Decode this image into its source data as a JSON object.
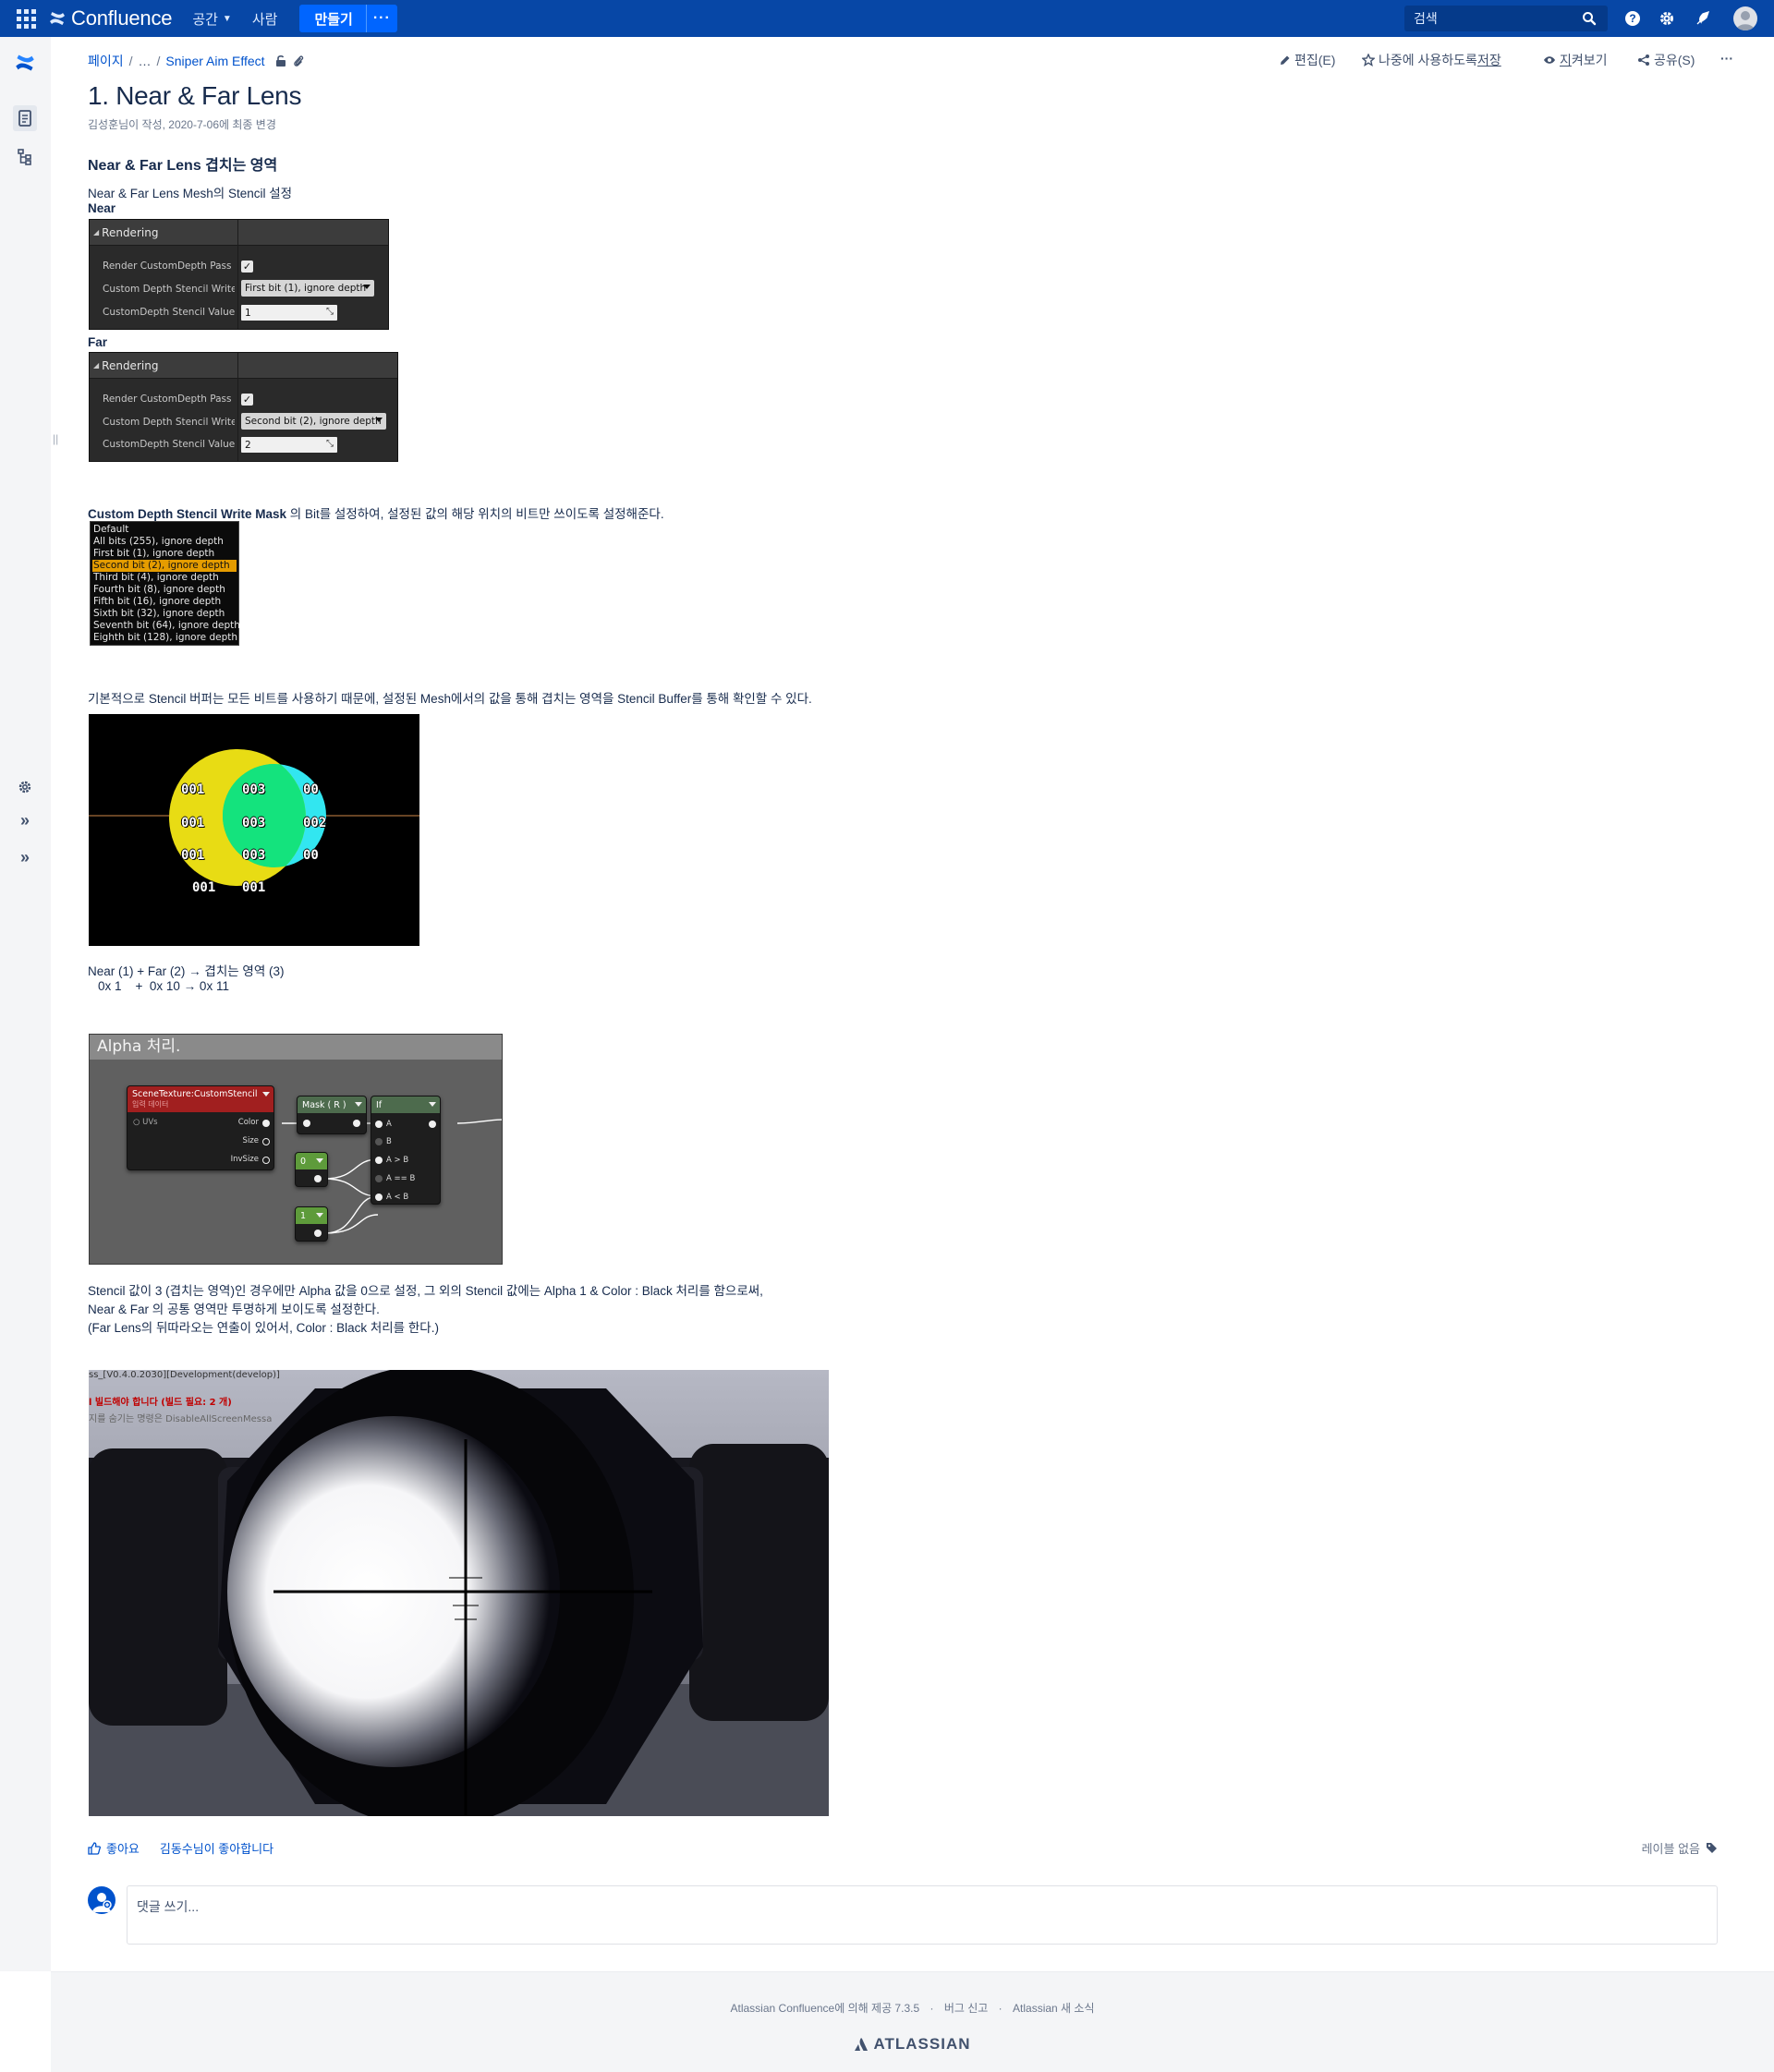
{
  "header": {
    "brand": "Confluence",
    "nav": [
      {
        "label": "공간",
        "has_caret": true
      },
      {
        "label": "사람",
        "has_caret": false
      }
    ],
    "create_label": "만들기",
    "more_label": "···",
    "search_placeholder": "검색",
    "icons": [
      "apps-grid-icon",
      "confluence-logo-icon",
      "search-icon",
      "help-icon",
      "settings-icon",
      "notifications-icon",
      "user-avatar"
    ],
    "colors": {
      "bar": "#0747a6",
      "create": "#0065ff"
    }
  },
  "breadcrumb": {
    "root": "페이지",
    "ellipsis": "…",
    "parent": "Sniper Aim Effect"
  },
  "page_actions": {
    "edit": "편집(E)",
    "save_later_prefix": "나중에 사용하도록 ",
    "save_later_key": "저장",
    "watch_key": "지",
    "watch_rest": "켜보기",
    "share": "공유(S)",
    "more": "···"
  },
  "page": {
    "title": "1. Near & Far Lens",
    "byline": "김성훈님이 작성, 2020-7-06에 최종 변경"
  },
  "content": {
    "section_heading": "Near & Far Lens 겹치는 영역",
    "intro": "Near & Far Lens Mesh의 Stencil 설정",
    "near_label": "Near",
    "far_label": "Far",
    "near_panel": {
      "header": "Rendering",
      "row1": "Render CustomDepth Pass",
      "row1_checked": true,
      "row2": "Custom Depth Stencil Write M",
      "row2_value": "First bit (1), ignore depth",
      "row3": "CustomDepth Stencil Value",
      "row3_value": "1"
    },
    "far_panel": {
      "header": "Rendering",
      "row1": "Render CustomDepth Pass",
      "row1_checked": true,
      "row2": "Custom Depth Stencil Write M",
      "row2_value": "Second bit (2), ignore depth",
      "row3": "CustomDepth Stencil Value",
      "row3_value": "2"
    },
    "mask_desc_bold": "Custom Depth Stencil Write Mask",
    "mask_desc_rest": " 의 Bit를 설정하여, 설정된 값의 해당 위치의 비트만 쓰이도록 설정해준다.",
    "mask_options": [
      "Default",
      "All bits (255), ignore depth",
      "First bit (1), ignore depth",
      "Second bit (2), ignore depth",
      "Third bit (4), ignore depth",
      "Fourth bit (8), ignore depth",
      "Fifth bit (16), ignore depth",
      "Sixth bit (32), ignore depth",
      "Seventh bit (64), ignore depth",
      "Eighth bit (128), ignore depth"
    ],
    "mask_selected": "Second bit (2), ignore depth",
    "stencil_desc": "기본적으로 Stencil 버퍼는 모든 비트를 사용하기 때문에, 설정된 Mesh에서의 값을 통해 겹치는 영역을 Stencil Buffer를 통해 확인할 수 있다.",
    "stencil_labels": {
      "r1": [
        "001",
        "003",
        "00"
      ],
      "r2": [
        "001",
        "003",
        "002"
      ],
      "r3": [
        "001",
        "003",
        "00"
      ],
      "r4": [
        "001",
        "001"
      ]
    },
    "formula_line1": "Near (1) + Far (2) → 겹치는 영역 (3)",
    "formula_line2": "0x 1    +  0x 10 → 0x 11",
    "graph": {
      "title": "Alpha 처리.",
      "scene_node": "SceneTexture:CustomStencil",
      "scene_sub": "입력 데이터",
      "uvs": "UVs",
      "color": "Color",
      "size": "Size",
      "invsize": "InvSize",
      "mask_node": "Mask ( R )",
      "const0": "0",
      "const1": "1",
      "if_node": "If",
      "if_pins": [
        "A",
        "B",
        "A > B",
        "A == B",
        "A < B"
      ]
    },
    "alpha_desc_1": "Stencil 값이 3 (겹치는 영역)인 경우에만 Alpha 값을 0으로 설정, 그 외의 Stencil 값에는 Alpha 1 & Color : Black 처리를 함으로써,",
    "alpha_desc_2": "Near & Far 의 공통 영역만 투명하게 보이도록 설정한다.",
    "alpha_desc_3": "(Far Lens의 뒤따라오는 연출이 있어서, Color : Black 처리를 한다.)",
    "scope_overlay": {
      "line1": "ss_[V0.4.0.2030][Development(develop)]",
      "line2": "l 빌드해야 합니다 (빌드 필요: 2 개)",
      "line3": "지를 숨기는 명령은 DisableAllScreenMessa"
    }
  },
  "footer_area": {
    "like": "좋아요",
    "liked_by": "김동수님이 좋아합니다",
    "no_labels": "레이블 없음",
    "comment_placeholder": "댓글 쓰기...",
    "powered_by": "Atlassian Confluence에 의해 제공 7.3.5",
    "report_bug": "버그 신고",
    "atlassian_news": "Atlassian 새 소식",
    "atlassian": "ATLASSIAN"
  }
}
